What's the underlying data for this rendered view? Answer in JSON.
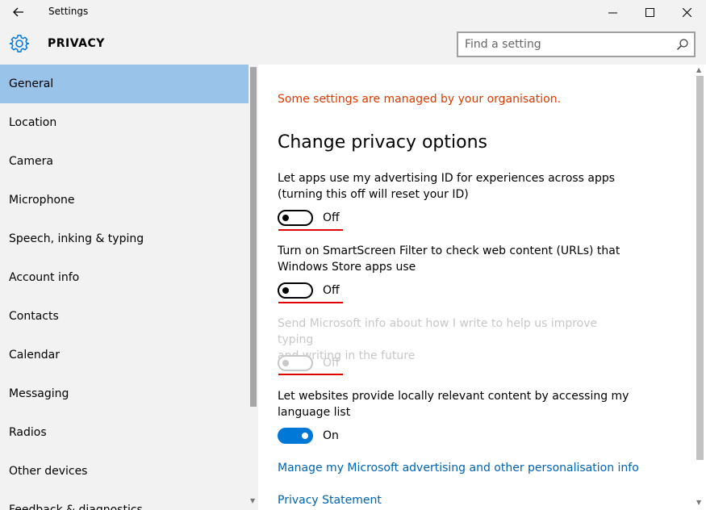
{
  "window": {
    "title": "Settings"
  },
  "header": {
    "title": "PRIVACY",
    "search_placeholder": "Find a setting"
  },
  "sidebar": {
    "items": [
      {
        "label": "General",
        "selected": true
      },
      {
        "label": "Location"
      },
      {
        "label": "Camera"
      },
      {
        "label": "Microphone"
      },
      {
        "label": "Speech, inking & typing"
      },
      {
        "label": "Account info"
      },
      {
        "label": "Contacts"
      },
      {
        "label": "Calendar"
      },
      {
        "label": "Messaging"
      },
      {
        "label": "Radios"
      },
      {
        "label": "Other devices"
      },
      {
        "label": "Feedback & diagnostics"
      }
    ]
  },
  "main": {
    "notice": "Some settings are managed by your organisation.",
    "section_title": "Change privacy options",
    "options": [
      {
        "line1": "Let apps use my advertising ID for experiences across apps",
        "line2": "(turning this off will reset your ID)",
        "state": "Off",
        "enabled": true
      },
      {
        "line1": "Turn on SmartScreen Filter to check web content (URLs) that",
        "line2": "Windows Store apps use",
        "state": "Off",
        "enabled": true
      },
      {
        "line1": "Send Microsoft info about how I write to help us improve typing",
        "line2": "and writing in the future",
        "state": "Off",
        "enabled": false
      },
      {
        "line1": "Let websites provide locally relevant content by accessing my",
        "line2": "language list",
        "state": "On",
        "enabled": true
      }
    ],
    "links": {
      "advertising": "Manage my Microsoft advertising and other personalisation info",
      "privacy": "Privacy Statement"
    }
  },
  "colors": {
    "accent": "#0078d7",
    "selected_nav": "#99c3e9",
    "notice": "#d83b01",
    "link": "#0063b1",
    "annotation_underline": "#e00000"
  }
}
